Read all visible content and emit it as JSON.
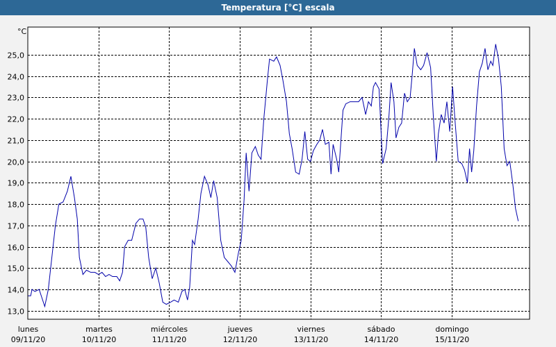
{
  "window": {
    "title": "Temperatura [°C] escala"
  },
  "colors": {
    "title_bar": "#2d6896",
    "line": "#0000aa",
    "grid": "#000000",
    "plot_bg": "#ffffff",
    "frame_bg": "#f2f2f2"
  },
  "chart_data": {
    "type": "line",
    "title": "Temperatura [°C] escala",
    "y_unit": "°C",
    "xlabel": "",
    "ylabel": "",
    "ylim": [
      12.6,
      26.3
    ],
    "xlim": [
      0,
      7.1
    ],
    "grid": true,
    "x_ticks": [
      {
        "x": 0,
        "day": "lunes",
        "date": "09/11/20"
      },
      {
        "x": 1,
        "day": "martes",
        "date": "10/11/20"
      },
      {
        "x": 2,
        "day": "miércoles",
        "date": "11/11/20"
      },
      {
        "x": 3,
        "day": "jueves",
        "date": "12/11/20"
      },
      {
        "x": 4,
        "day": "viernes",
        "date": "13/11/20"
      },
      {
        "x": 5,
        "day": "sábado",
        "date": "14/11/20"
      },
      {
        "x": 6,
        "day": "domingo",
        "date": "15/11/20"
      }
    ],
    "y_ticks": [
      "13,0",
      "14,0",
      "15,0",
      "16,0",
      "17,0",
      "18,0",
      "19,0",
      "20,0",
      "21,0",
      "22,0",
      "23,0",
      "24,0",
      "25,0"
    ],
    "y_tick_values": [
      13,
      14,
      15,
      16,
      17,
      18,
      19,
      20,
      21,
      22,
      23,
      24,
      25
    ],
    "series": [
      {
        "points": [
          [
            0.0,
            13.7
          ],
          [
            0.04,
            13.7
          ],
          [
            0.06,
            14.0
          ],
          [
            0.1,
            13.9
          ],
          [
            0.16,
            14.0
          ],
          [
            0.24,
            13.2
          ],
          [
            0.29,
            14.0
          ],
          [
            0.34,
            15.5
          ],
          [
            0.39,
            17.0
          ],
          [
            0.44,
            18.0
          ],
          [
            0.5,
            18.1
          ],
          [
            0.56,
            18.6
          ],
          [
            0.61,
            19.3
          ],
          [
            0.66,
            18.3
          ],
          [
            0.7,
            17.3
          ],
          [
            0.73,
            15.5
          ],
          [
            0.78,
            14.7
          ],
          [
            0.83,
            14.9
          ],
          [
            0.89,
            14.8
          ],
          [
            0.95,
            14.8
          ],
          [
            1.0,
            14.7
          ],
          [
            1.05,
            14.8
          ],
          [
            1.1,
            14.6
          ],
          [
            1.15,
            14.7
          ],
          [
            1.2,
            14.6
          ],
          [
            1.26,
            14.6
          ],
          [
            1.3,
            14.4
          ],
          [
            1.34,
            14.8
          ],
          [
            1.37,
            16.0
          ],
          [
            1.42,
            16.3
          ],
          [
            1.47,
            16.3
          ],
          [
            1.53,
            17.1
          ],
          [
            1.58,
            17.3
          ],
          [
            1.63,
            17.3
          ],
          [
            1.67,
            16.9
          ],
          [
            1.71,
            15.5
          ],
          [
            1.76,
            14.5
          ],
          [
            1.81,
            15.0
          ],
          [
            1.86,
            14.3
          ],
          [
            1.91,
            13.4
          ],
          [
            1.96,
            13.3
          ],
          [
            2.02,
            13.4
          ],
          [
            2.07,
            13.5
          ],
          [
            2.13,
            13.4
          ],
          [
            2.18,
            13.9
          ],
          [
            2.22,
            14.0
          ],
          [
            2.26,
            13.5
          ],
          [
            2.29,
            14.1
          ],
          [
            2.33,
            16.3
          ],
          [
            2.36,
            16.1
          ],
          [
            2.41,
            17.3
          ],
          [
            2.45,
            18.5
          ],
          [
            2.5,
            19.3
          ],
          [
            2.55,
            18.9
          ],
          [
            2.59,
            18.3
          ],
          [
            2.63,
            19.1
          ],
          [
            2.68,
            18.3
          ],
          [
            2.73,
            16.3
          ],
          [
            2.78,
            15.5
          ],
          [
            2.83,
            15.3
          ],
          [
            2.88,
            15.1
          ],
          [
            2.93,
            14.8
          ],
          [
            2.98,
            15.7
          ],
          [
            3.02,
            16.3
          ],
          [
            3.06,
            18.2
          ],
          [
            3.09,
            20.4
          ],
          [
            3.13,
            18.6
          ],
          [
            3.17,
            20.4
          ],
          [
            3.22,
            20.7
          ],
          [
            3.26,
            20.3
          ],
          [
            3.3,
            20.1
          ],
          [
            3.34,
            22.0
          ],
          [
            3.39,
            23.8
          ],
          [
            3.42,
            24.8
          ],
          [
            3.48,
            24.7
          ],
          [
            3.52,
            24.9
          ],
          [
            3.57,
            24.5
          ],
          [
            3.61,
            23.8
          ],
          [
            3.66,
            22.8
          ],
          [
            3.7,
            21.3
          ],
          [
            3.74,
            20.6
          ],
          [
            3.79,
            19.5
          ],
          [
            3.84,
            19.4
          ],
          [
            3.88,
            20.1
          ],
          [
            3.92,
            21.4
          ],
          [
            3.96,
            20.1
          ],
          [
            4.0,
            20.0
          ],
          [
            4.04,
            20.5
          ],
          [
            4.09,
            20.8
          ],
          [
            4.13,
            21.0
          ],
          [
            4.17,
            21.5
          ],
          [
            4.21,
            20.8
          ],
          [
            4.26,
            20.9
          ],
          [
            4.29,
            19.4
          ],
          [
            4.32,
            20.8
          ],
          [
            4.37,
            20.1
          ],
          [
            4.4,
            19.5
          ],
          [
            4.46,
            22.4
          ],
          [
            4.5,
            22.7
          ],
          [
            4.56,
            22.8
          ],
          [
            4.62,
            22.8
          ],
          [
            4.68,
            22.8
          ],
          [
            4.73,
            23.0
          ],
          [
            4.78,
            22.2
          ],
          [
            4.82,
            22.8
          ],
          [
            4.86,
            22.6
          ],
          [
            4.89,
            23.5
          ],
          [
            4.92,
            23.7
          ],
          [
            4.97,
            23.4
          ],
          [
            5.02,
            19.9
          ],
          [
            5.07,
            20.6
          ],
          [
            5.11,
            22.1
          ],
          [
            5.14,
            23.7
          ],
          [
            5.18,
            22.8
          ],
          [
            5.21,
            21.1
          ],
          [
            5.25,
            21.6
          ],
          [
            5.29,
            21.8
          ],
          [
            5.33,
            23.2
          ],
          [
            5.37,
            22.8
          ],
          [
            5.41,
            23.0
          ],
          [
            5.44,
            24.1
          ],
          [
            5.47,
            25.3
          ],
          [
            5.51,
            24.5
          ],
          [
            5.56,
            24.3
          ],
          [
            5.6,
            24.5
          ],
          [
            5.65,
            25.1
          ],
          [
            5.7,
            24.4
          ],
          [
            5.74,
            22.0
          ],
          [
            5.78,
            20.0
          ],
          [
            5.81,
            21.3
          ],
          [
            5.85,
            22.2
          ],
          [
            5.89,
            21.8
          ],
          [
            5.93,
            22.8
          ],
          [
            5.97,
            21.4
          ],
          [
            6.01,
            23.5
          ],
          [
            6.05,
            21.7
          ],
          [
            6.09,
            20.0
          ],
          [
            6.14,
            19.9
          ],
          [
            6.18,
            19.6
          ],
          [
            6.22,
            19.0
          ],
          [
            6.25,
            20.6
          ],
          [
            6.28,
            19.5
          ],
          [
            6.31,
            20.5
          ],
          [
            6.35,
            22.6
          ],
          [
            6.39,
            24.2
          ],
          [
            6.43,
            24.6
          ],
          [
            6.47,
            25.3
          ],
          [
            6.51,
            24.3
          ],
          [
            6.55,
            24.7
          ],
          [
            6.58,
            24.5
          ],
          [
            6.62,
            25.5
          ],
          [
            6.66,
            24.8
          ],
          [
            6.7,
            23.5
          ],
          [
            6.74,
            20.6
          ],
          [
            6.78,
            19.8
          ],
          [
            6.82,
            20.0
          ],
          [
            6.86,
            19.0
          ],
          [
            6.9,
            17.8
          ],
          [
            6.94,
            17.2
          ]
        ]
      }
    ]
  }
}
